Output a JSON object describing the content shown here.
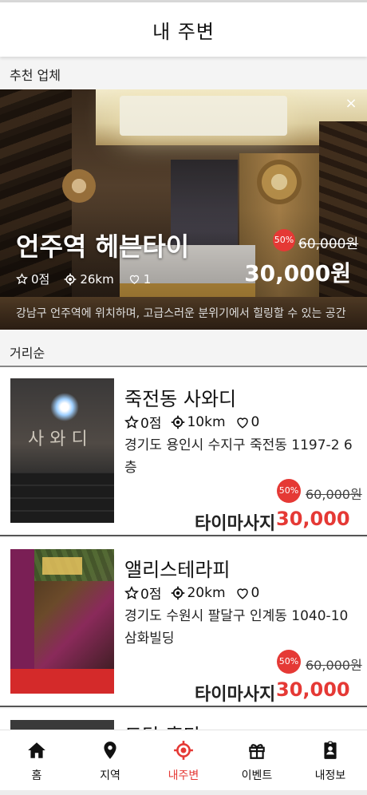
{
  "header": {
    "title": "내 주변"
  },
  "sections": {
    "recommended": "추천 업체",
    "sort_label": "거리순"
  },
  "featured": {
    "name": "언주역 헤븐타이",
    "rating": "0점",
    "distance": "26km",
    "likes": "1",
    "discount": "50%",
    "original_price": "60,000원",
    "price": "30,000원",
    "description": "강남구 언주역에 위치하며, 고급스러운 분위기에서 힐링할 수 있는 공간",
    "close_label": "×"
  },
  "shops": [
    {
      "name": "죽전동 사와디",
      "rating": "0점",
      "distance": "10km",
      "likes": "0",
      "address": "경기도 용인시 수지구 죽전동 1197-2 6층",
      "discount": "50%",
      "original_price": "60,000원",
      "category": "타이마사지",
      "price": "30,000원"
    },
    {
      "name": "앨리스테라피",
      "rating": "0점",
      "distance": "20km",
      "likes": "0",
      "address": "경기도 수원시 팔달구 인계동 1040-10 삼화빌딩",
      "discount": "50%",
      "original_price": "60,000원",
      "category": "타이마사지",
      "price": "30,000원"
    },
    {
      "name": "도담 홈타"
    }
  ],
  "tabs": [
    {
      "label": "홈",
      "icon": "home-icon"
    },
    {
      "label": "지역",
      "icon": "map-pin-icon"
    },
    {
      "label": "내주변",
      "icon": "location-target-icon",
      "active": true
    },
    {
      "label": "이벤트",
      "icon": "gift-icon"
    },
    {
      "label": "내정보",
      "icon": "profile-badge-icon"
    }
  ],
  "colors": {
    "accent": "#e53935",
    "text": "#111111",
    "background": "#f4f4f4"
  }
}
